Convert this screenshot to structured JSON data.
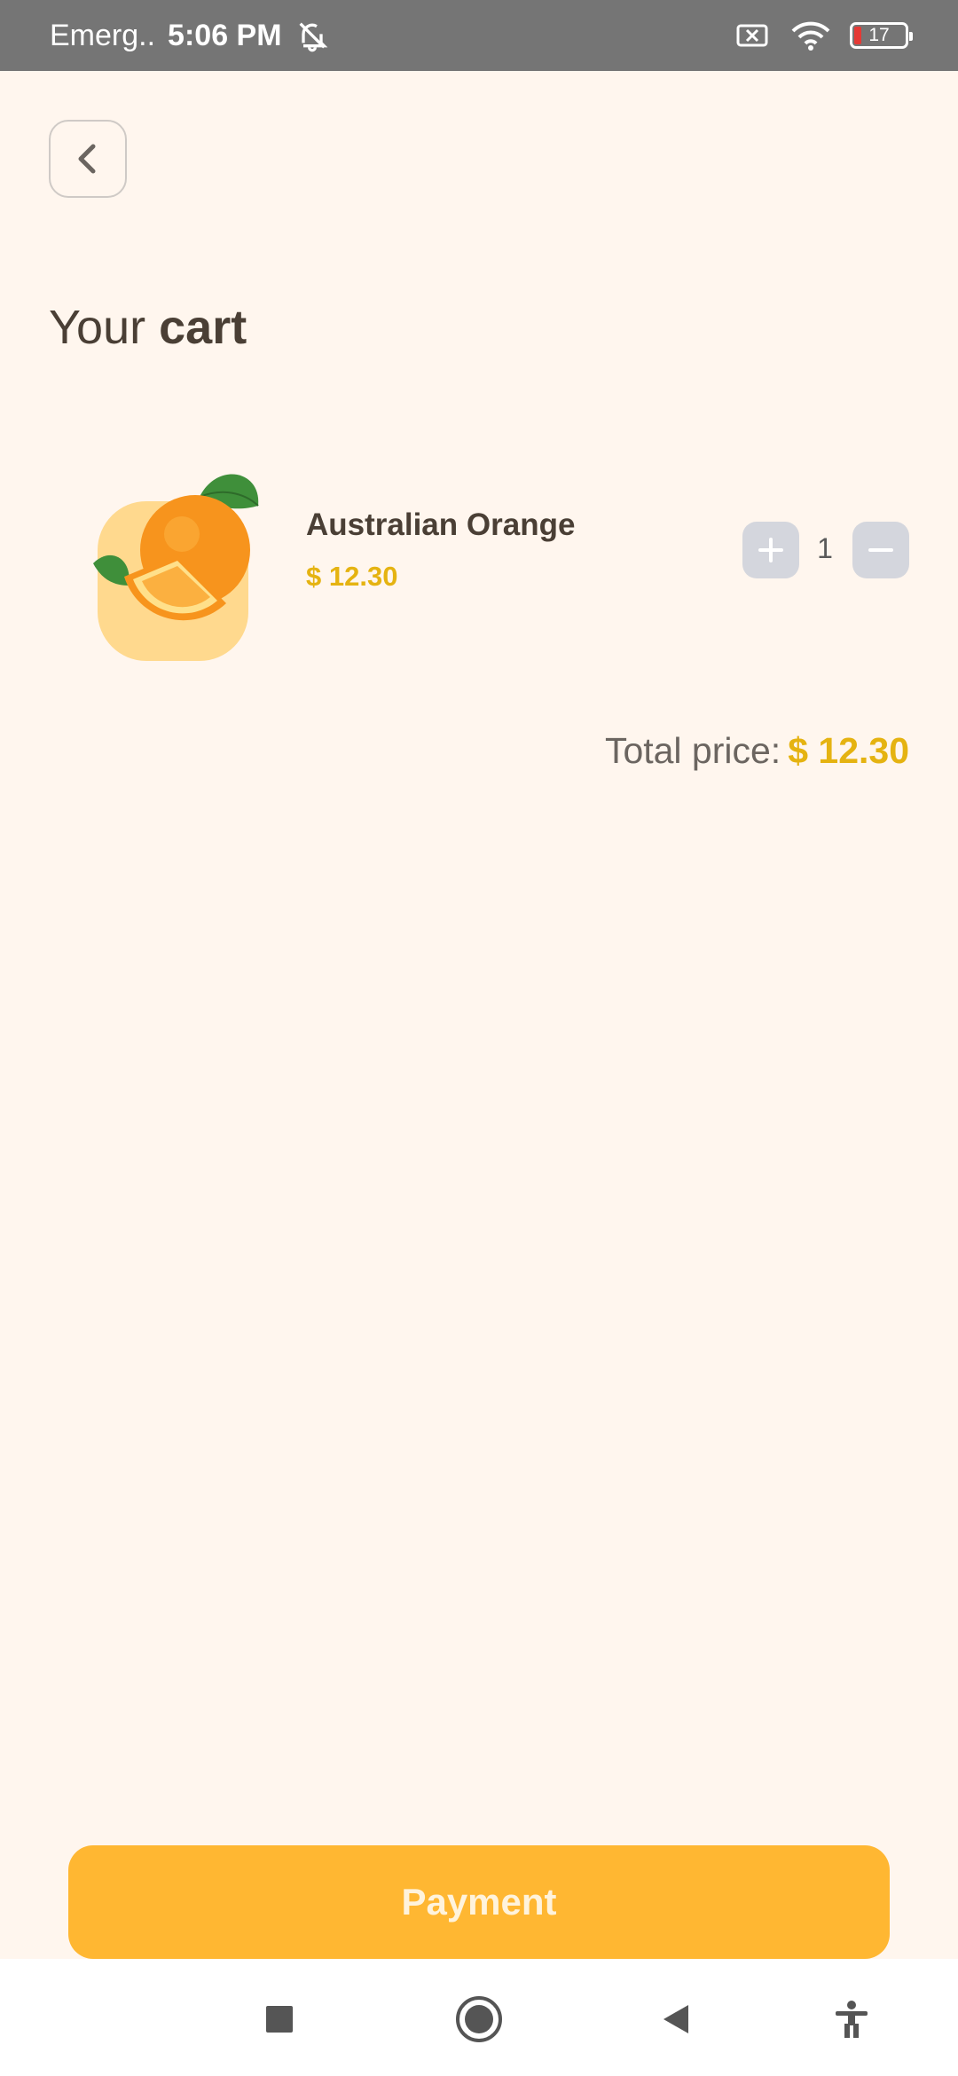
{
  "status_bar": {
    "carrier": "Emerg..",
    "time": "5:06 PM",
    "battery_level": "17",
    "icons": [
      "bell-off-icon",
      "sim-off-icon",
      "wifi-icon",
      "battery-icon"
    ]
  },
  "header": {
    "back_icon": "chevron-left-icon",
    "title_regular": "Your",
    "title_bold": "cart"
  },
  "cart": {
    "items": [
      {
        "name": "Australian Orange",
        "price": "$ 12.30",
        "quantity": "1",
        "image": "orange-image"
      }
    ]
  },
  "summary": {
    "total_label": "Total price:",
    "total_amount": "$ 12.30"
  },
  "actions": {
    "payment_label": "Payment"
  },
  "nav": {
    "icons": [
      "recents-icon",
      "home-icon",
      "back-icon",
      "accessibility-icon"
    ]
  },
  "colors": {
    "background": "#FFF6EE",
    "accent": "#FFB732",
    "price": "#E5B311",
    "text": "#4a3f35",
    "qty_button": "#D4D6DD"
  }
}
